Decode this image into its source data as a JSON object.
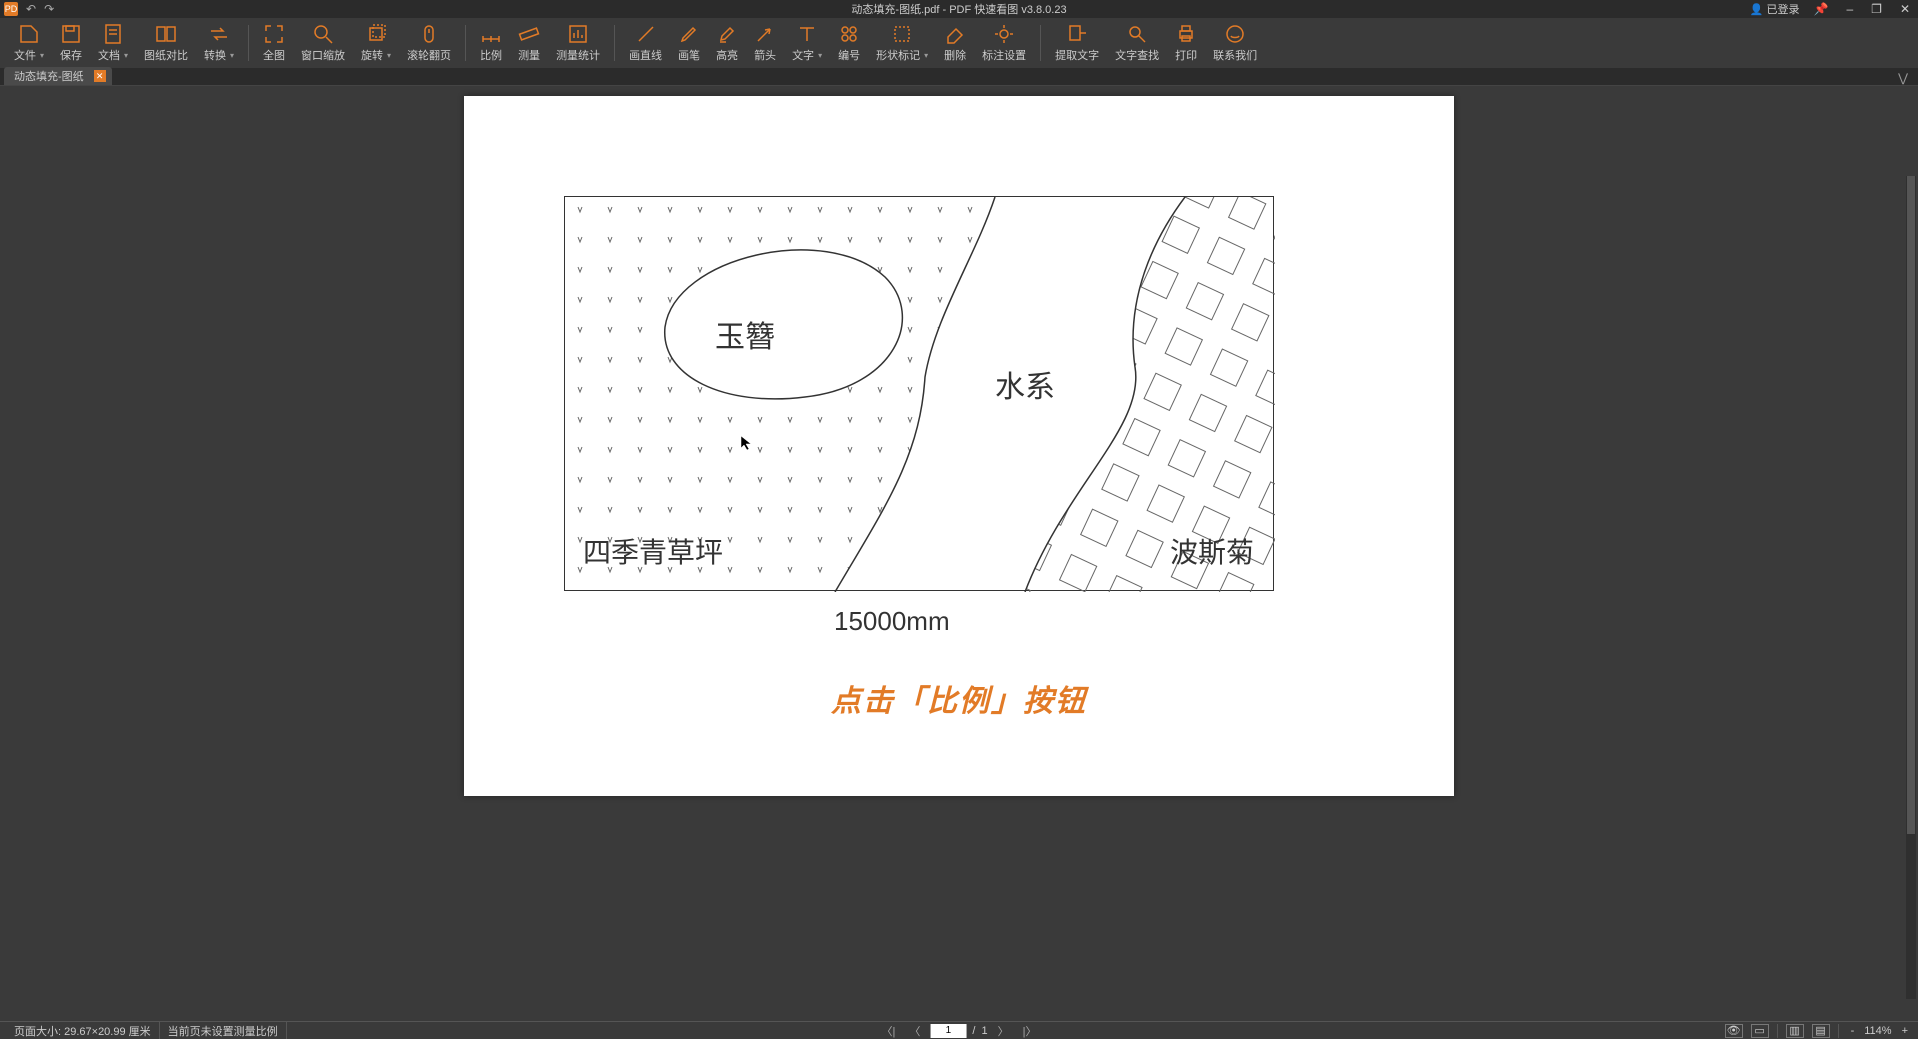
{
  "app": {
    "logo": "PD",
    "title": "动态填充-图纸.pdf - PDF 快速看图 v3.8.0.23",
    "user_label": "已登录"
  },
  "window": {
    "pin": "📌",
    "min": "–",
    "max": "❐",
    "close": "✕"
  },
  "qat": {
    "undo": "↶",
    "redo": "↷"
  },
  "ribbon": {
    "file": "文件",
    "save": "保存",
    "doc": "文档",
    "compare": "图纸对比",
    "convert": "转换",
    "full": "全图",
    "winzoom": "窗口缩放",
    "rotate": "旋转",
    "scroll": "滚轮翻页",
    "scale": "比例",
    "measure": "测量",
    "measurestat": "测量统计",
    "line": "画直线",
    "pen": "画笔",
    "highlight": "高亮",
    "arrow": "箭头",
    "text": "文字",
    "number": "编号",
    "shape": "形状标记",
    "delete": "删除",
    "annot": "标注设置",
    "extract": "提取文字",
    "find": "文字查找",
    "print": "打印",
    "contact": "联系我们"
  },
  "tab": {
    "name": "动态填充-图纸",
    "close": "✕"
  },
  "tabstrip": {
    "expand": "⋁"
  },
  "drawing": {
    "label1": "玉簪",
    "label2": "水系",
    "label3": "四季青草坪",
    "label4": "波斯菊",
    "dimension": "15000mm"
  },
  "annotation": "点击「比例」按钮",
  "status": {
    "page_size": "页面大小: 29.67×20.99 厘米",
    "scale_msg": "当前页未设置测量比例",
    "page_current": "1",
    "page_sep": "/",
    "page_total": "1",
    "prev_jump": "〈|",
    "prev": "〈",
    "next": "〉",
    "next_jump": "|〉",
    "zoom_out": "-",
    "zoom_in": "+",
    "zoom_level": "114%"
  },
  "viewmodes": {
    "eye": "👁",
    "doc": "▭",
    "grid1": "▥",
    "grid2": "▤"
  }
}
